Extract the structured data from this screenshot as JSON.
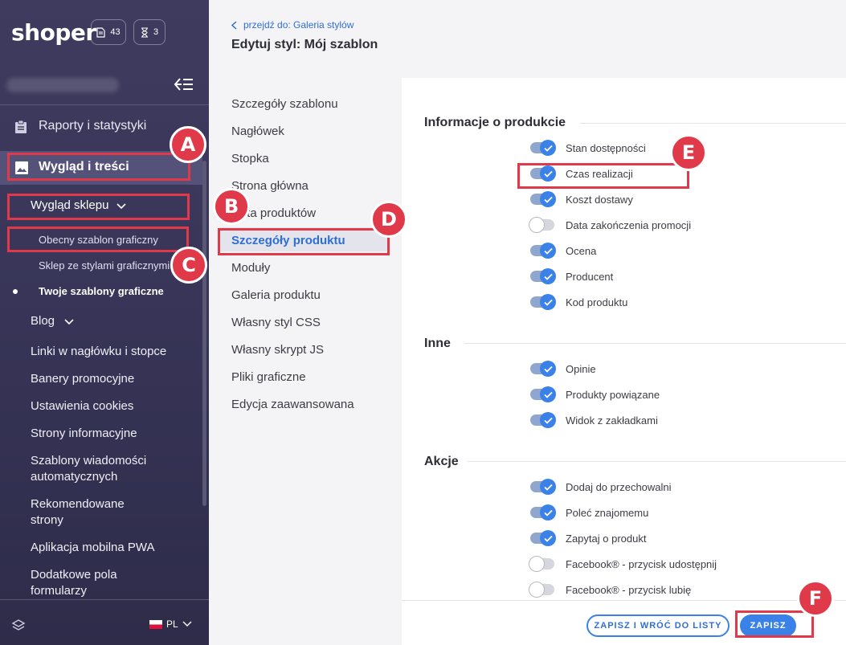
{
  "app": {
    "logo": "shoper",
    "counter_docs": "43",
    "counter_timer": "3"
  },
  "sidebar": {
    "reports": "Raporty i statystyki",
    "appearance": "Wygląd i treści",
    "shop_look": "Wygląd sklepu",
    "current_template": "Obecny szablon graficzny",
    "styles_shop": "Sklep ze stylami graficznymi",
    "your_templates": "Twoje szablony graficzne",
    "blog": "Blog",
    "items": [
      "Linki w nagłówku i stopce",
      "Banery promocyjne",
      "Ustawienia cookies",
      "Strony informacyjne",
      "Szablony wiadomości automatycznych",
      "Rekomendowane strony",
      "Aplikacja mobilna PWA",
      "Dodatkowe pola formularzy"
    ],
    "language": "PL"
  },
  "header": {
    "breadcrumb": "przejdź do: Galeria stylów",
    "title": "Edytuj styl: Mój szablon"
  },
  "midnav": [
    "Szczegóły szablonu",
    "Nagłówek",
    "Stopka",
    "Strona główna",
    "Lista produktów",
    "Szczegóły produktu",
    "Moduły",
    "Galeria produktu",
    "Własny styl CSS",
    "Własny skrypt JS",
    "Pliki graficzne",
    "Edycja zaawansowana"
  ],
  "sections": [
    {
      "title": "Informacje o produkcie",
      "options": [
        {
          "label": "Stan dostępności",
          "on": true
        },
        {
          "label": "Czas realizacji",
          "on": true
        },
        {
          "label": "Koszt dostawy",
          "on": true
        },
        {
          "label": "Data zakończenia promocji",
          "on": false
        },
        {
          "label": "Ocena",
          "on": true
        },
        {
          "label": "Producent",
          "on": true
        },
        {
          "label": "Kod produktu",
          "on": true
        }
      ]
    },
    {
      "title": "Inne",
      "options": [
        {
          "label": "Opinie",
          "on": true
        },
        {
          "label": "Produkty powiązane",
          "on": true
        },
        {
          "label": "Widok z zakładkami",
          "on": true
        }
      ]
    },
    {
      "title": "Akcje",
      "options": [
        {
          "label": "Dodaj do przechowalni",
          "on": true
        },
        {
          "label": "Poleć znajomemu",
          "on": true
        },
        {
          "label": "Zapytaj o produkt",
          "on": true
        },
        {
          "label": "Facebook® - przycisk udostępnij",
          "on": false
        },
        {
          "label": "Facebook® - przycisk lubię",
          "on": false
        }
      ]
    }
  ],
  "footer": {
    "save_back": "ZAPISZ I WRÓĆ DO LISTY",
    "save": "ZAPISZ"
  },
  "markers": {
    "a": "A",
    "b": "B",
    "c": "C",
    "d": "D",
    "e": "E",
    "f": "F"
  },
  "colors": {
    "accent": "#3b82e8",
    "highlight": "#e03a4a",
    "sidebar": "#3f3b5e"
  }
}
